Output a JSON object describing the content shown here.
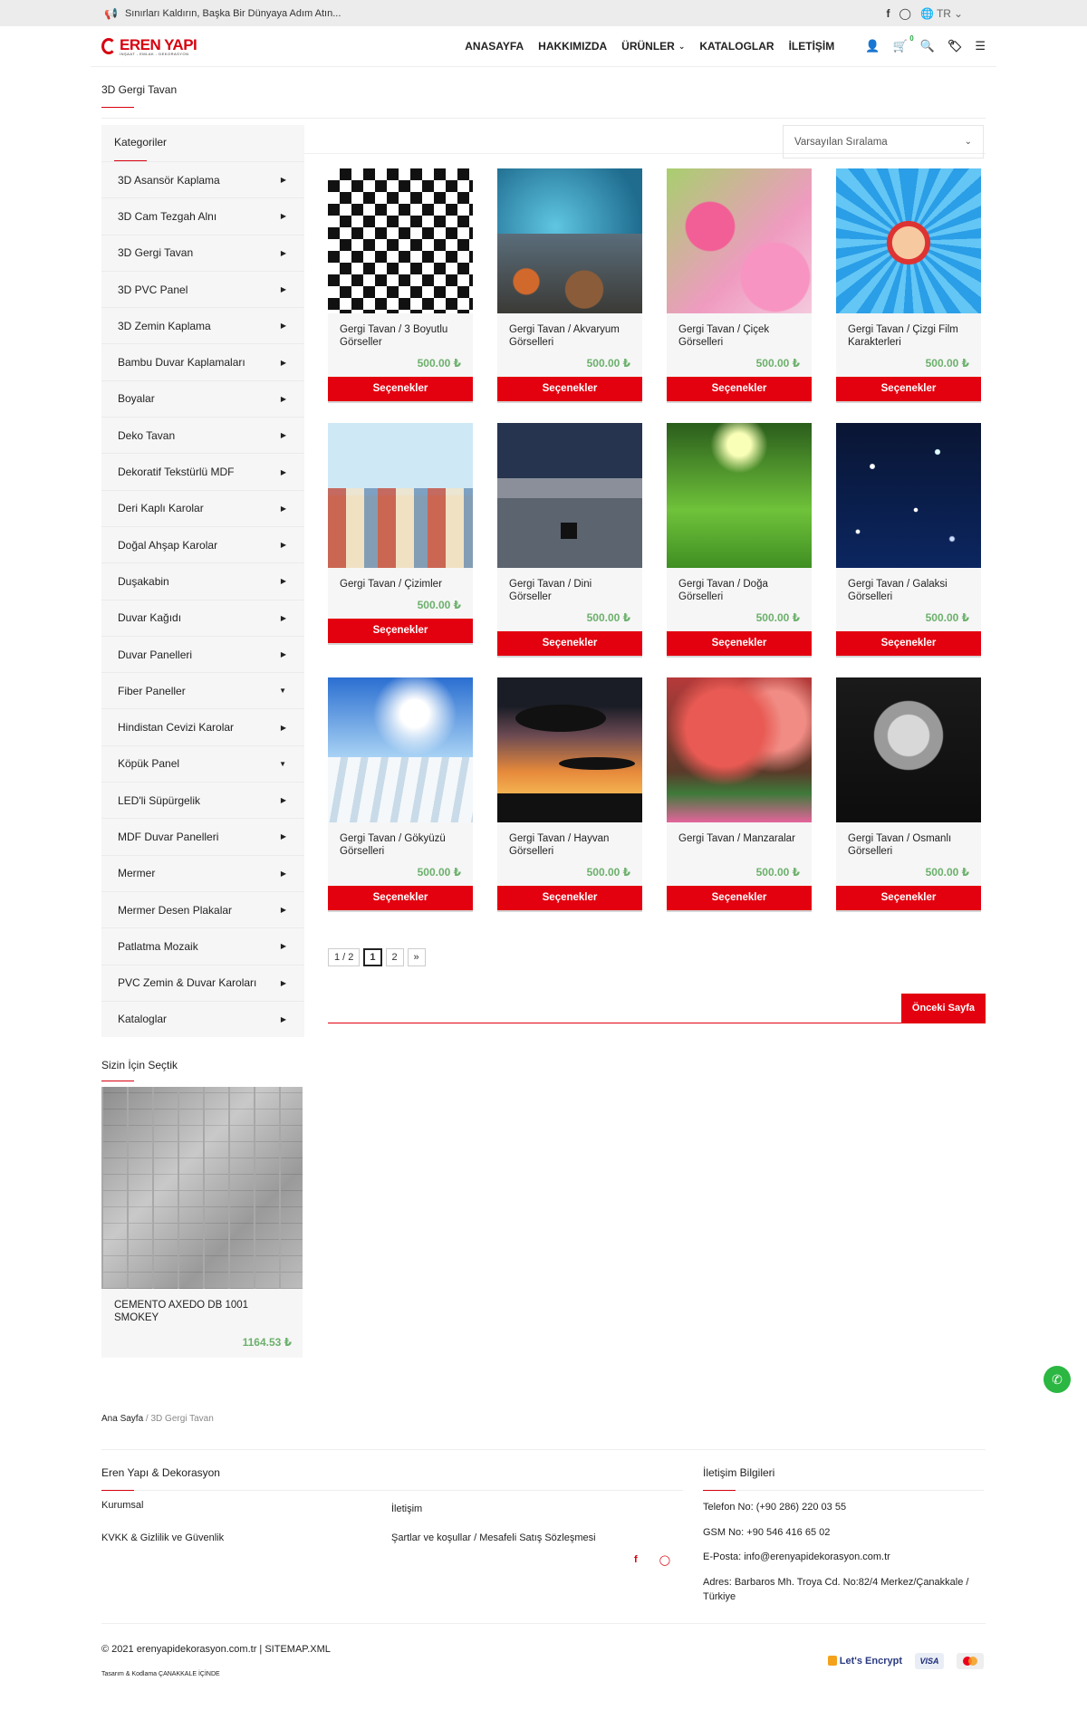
{
  "topbar": {
    "announcement": "Sınırları Kaldırın, Başka Bir Dünyaya Adım Atın...",
    "language": "TR"
  },
  "header": {
    "logo_text": "EREN YAPI",
    "logo_tagline": "İNŞAAT - EMLAK - DEKORASYON",
    "nav": [
      {
        "label": "ANASAYFA"
      },
      {
        "label": "HAKKIMIZDA"
      },
      {
        "label": "ÜRÜNLER"
      },
      {
        "label": "KATALOGLAR"
      },
      {
        "label": "İLETİŞİM"
      }
    ],
    "cart_count": "0"
  },
  "page": {
    "title": "3D Gergi Tavan"
  },
  "sidebar": {
    "categories_title": "Kategoriler",
    "items": [
      {
        "label": "3D Asansör Kaplama",
        "arrow": "▶"
      },
      {
        "label": "3D Cam Tezgah Alnı",
        "arrow": "▶"
      },
      {
        "label": "3D Gergi Tavan",
        "arrow": "▶"
      },
      {
        "label": "3D PVC Panel",
        "arrow": "▶"
      },
      {
        "label": "3D Zemin Kaplama",
        "arrow": "▶"
      },
      {
        "label": "Bambu Duvar Kaplamaları",
        "arrow": "▶"
      },
      {
        "label": "Boyalar",
        "arrow": "▶"
      },
      {
        "label": "Deko Tavan",
        "arrow": "▶"
      },
      {
        "label": "Dekoratif Tekstürlü MDF",
        "arrow": "▶"
      },
      {
        "label": "Deri Kaplı Karolar",
        "arrow": "▶"
      },
      {
        "label": "Doğal Ahşap Karolar",
        "arrow": "▶"
      },
      {
        "label": "Duşakabin",
        "arrow": "▶"
      },
      {
        "label": "Duvar Kağıdı",
        "arrow": "▶"
      },
      {
        "label": "Duvar Panelleri",
        "arrow": "▶"
      },
      {
        "label": "Fiber Paneller",
        "arrow": "▼"
      },
      {
        "label": "Hindistan Cevizi Karolar",
        "arrow": "▶"
      },
      {
        "label": "Köpük Panel",
        "arrow": "▼"
      },
      {
        "label": "LED'li Süpürgelik",
        "arrow": "▶"
      },
      {
        "label": "MDF Duvar Panelleri",
        "arrow": "▶"
      },
      {
        "label": "Mermer",
        "arrow": "▶"
      },
      {
        "label": "Mermer Desen Plakalar",
        "arrow": "▶"
      },
      {
        "label": "Patlatma Mozaik",
        "arrow": "▶"
      },
      {
        "label": "PVC Zemin & Duvar Karoları",
        "arrow": "▶"
      },
      {
        "label": "Kataloglar",
        "arrow": "▶"
      }
    ],
    "pick_title": "Sizin İçin Seçtik",
    "pick_product": {
      "title": "CEMENTO AXEDO DB 1001 SMOKEY",
      "price": "1164.53 ₺"
    }
  },
  "main": {
    "sort_label": "Varsayılan Sıralama",
    "option_label": "Seçenekler",
    "products": [
      {
        "title": "Gergi Tavan / 3 Boyutlu Görseller",
        "price": "500.00 ₺",
        "image": "chess"
      },
      {
        "title": "Gergi Tavan / Akvaryum Görselleri",
        "price": "500.00 ₺",
        "image": "aqua"
      },
      {
        "title": "Gergi Tavan / Çiçek Görselleri",
        "price": "500.00 ₺",
        "image": "flower"
      },
      {
        "title": "Gergi Tavan / Çizgi Film Karakterleri",
        "price": "500.00 ₺",
        "image": "cartoon"
      },
      {
        "title": "Gergi Tavan / Çizimler",
        "price": "500.00 ₺",
        "image": "city"
      },
      {
        "title": "Gergi Tavan / Dini Görseller",
        "price": "500.00 ₺",
        "image": "mecca"
      },
      {
        "title": "Gergi Tavan / Doğa Görselleri",
        "price": "500.00 ₺",
        "image": "nature"
      },
      {
        "title": "Gergi Tavan / Galaksi Görselleri",
        "price": "500.00 ₺",
        "image": "galaxy"
      },
      {
        "title": "Gergi Tavan / Gökyüzü Görselleri",
        "price": "500.00 ₺",
        "image": "sky"
      },
      {
        "title": "Gergi Tavan / Hayvan Görselleri",
        "price": "500.00 ₺",
        "image": "savanna"
      },
      {
        "title": "Gergi Tavan / Manzaralar",
        "price": "500.00 ₺",
        "image": "landscape"
      },
      {
        "title": "Gergi Tavan / Osmanlı Görselleri",
        "price": "500.00 ₺",
        "image": "ottoman"
      }
    ],
    "pagination": {
      "info": "1 / 2",
      "pages": [
        "1",
        "2"
      ],
      "next": "»",
      "current": "1"
    },
    "prev_page": "Önceki Sayfa"
  },
  "breadcrumb": {
    "home": "Ana Sayfa",
    "sep": " / ",
    "current": "3D Gergi Tavan"
  },
  "footer": {
    "company_title": "Eren Yapı & Dekorasyon",
    "links": {
      "kurumsal": "Kurumsal",
      "iletisim": "İletişim",
      "kvkk": "KVKK & Gizlilik ve Güvenlik",
      "sartlar": "Şartlar ve koşullar / Mesafeli Satış Sözleşmesi"
    },
    "contact_title": "İletişim Bilgileri",
    "phone": "Telefon No: (+90 286) 220 03 55",
    "gsm": "GSM No: +90 546 416 65 02",
    "email": "E-Posta: info@erenyapidekorasyon.com.tr",
    "address": "Adres: Barbaros Mh. Troya Cd. No:82/4 Merkez/Çanakkale / Türkiye",
    "copyright": "© 2021 erenyapidekorasyon.com.tr | ",
    "sitemap": "SITEMAP.XML",
    "design": "Tasarım & Kodlama ÇANAKKALE İÇİNDE",
    "lets_encrypt": "Let's Encrypt",
    "visa": "VISA"
  },
  "colors": {
    "accent": "#e3000f",
    "price": "#6cb06c",
    "whatsapp": "#2bb741"
  }
}
